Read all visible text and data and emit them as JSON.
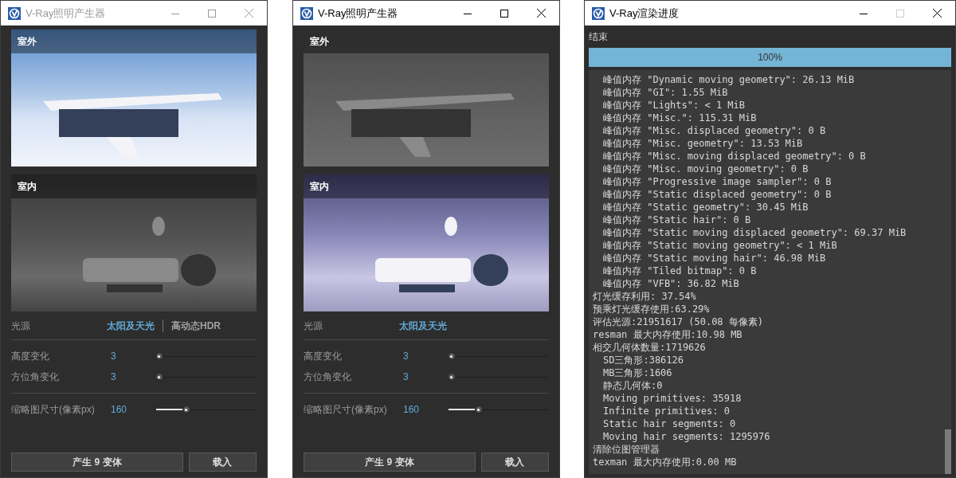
{
  "windows": [
    {
      "kind": "generator",
      "title": "V-Ray照明产生器",
      "active": false,
      "maximize_disabled": false,
      "previews": [
        {
          "kind": "exterior",
          "label": "室外",
          "selected": true
        },
        {
          "kind": "interior",
          "label": "室内",
          "selected": false
        }
      ],
      "light_source": {
        "label": "光源",
        "options": [
          {
            "label": "太阳及天光",
            "selected": true
          },
          {
            "label": "高动态HDR",
            "selected": false
          }
        ]
      },
      "slider_groups": [
        {
          "sliders": [
            {
              "label": "高度变化",
              "value": "3",
              "level": 0.03
            },
            {
              "label": "方位角变化",
              "value": "3",
              "level": 0.03
            }
          ]
        },
        {
          "sliders": [
            {
              "label": "缩略图尺寸(像素px)",
              "value": "160",
              "level": 0.3
            }
          ]
        }
      ],
      "buttons": [
        "产生 9 变体",
        "载入"
      ]
    },
    {
      "kind": "generator",
      "title": "V-Ray照明产生器",
      "active": true,
      "maximize_disabled": false,
      "previews": [
        {
          "kind": "exterior",
          "label": "室外",
          "selected": false
        },
        {
          "kind": "interior",
          "label": "室内",
          "selected": true
        }
      ],
      "light_source": {
        "label": "光源",
        "options": [
          {
            "label": "太阳及天光",
            "selected": true
          }
        ]
      },
      "slider_groups": [
        {
          "sliders": [
            {
              "label": "高度变化",
              "value": "3",
              "level": 0.03
            },
            {
              "label": "方位角变化",
              "value": "3",
              "level": 0.03
            }
          ]
        },
        {
          "sliders": [
            {
              "label": "缩略图尺寸(像素px)",
              "value": "160",
              "level": 0.3
            }
          ]
        }
      ],
      "buttons": [
        "产生 9 变体",
        "载入"
      ]
    },
    {
      "kind": "progress",
      "title": "V-Ray渲染进度",
      "active": true,
      "maximize_disabled": true,
      "status": "结束",
      "progress": {
        "label": "100%",
        "level": 1
      },
      "log": [
        {
          "children": [
            {
              "text": "峰值内存 \"Dynamic moving geometry\": 26.13 MiB"
            },
            {
              "text": "峰值内存 \"GI\": 1.55 MiB"
            },
            {
              "text": "峰值内存 \"Lights\": < 1 MiB"
            },
            {
              "text": "峰值内存 \"Misc.\": 115.31 MiB"
            },
            {
              "text": "峰值内存 \"Misc. displaced geometry\": 0 B"
            },
            {
              "text": "峰值内存 \"Misc. geometry\": 13.53 MiB"
            },
            {
              "text": "峰值内存 \"Misc. moving displaced geometry\": 0 B"
            },
            {
              "text": "峰值内存 \"Misc. moving geometry\": 0 B"
            },
            {
              "text": "峰值内存 \"Progressive image sampler\": 0 B"
            },
            {
              "text": "峰值内存 \"Static displaced geometry\": 0 B"
            },
            {
              "text": "峰值内存 \"Static geometry\": 30.45 MiB"
            },
            {
              "text": "峰值内存 \"Static hair\": 0 B"
            },
            {
              "text": "峰值内存 \"Static moving displaced geometry\": 69.37 MiB"
            },
            {
              "text": "峰值内存 \"Static moving geometry\": < 1 MiB"
            },
            {
              "text": "峰值内存 \"Static moving hair\": 46.98 MiB"
            },
            {
              "text": "峰值内存 \"Tiled bitmap\": 0 B"
            },
            {
              "text": "峰值内存 \"VFB\": 36.82 MiB"
            }
          ]
        },
        {
          "text": "灯光缓存利用: 37.54%"
        },
        {
          "text": "预乘灯光缓存使用:63.29%"
        },
        {
          "text": "评估光源:21951617 (50.08 每像素)"
        },
        {
          "text": "resman 最大内存使用:10.98 MB"
        },
        {
          "text": "相交几何体数量:1719626",
          "children": [
            {
              "text": "SD三角形:386126"
            },
            {
              "text": "MB三角形:1606"
            },
            {
              "text": "静态几何体:0"
            },
            {
              "text": "Moving primitives: 35918"
            },
            {
              "text": "Infinite primitives: 0"
            },
            {
              "text": "Static hair segments: 0"
            },
            {
              "text": "Moving hair segments: 1295976"
            }
          ]
        },
        {
          "text": "清除位图管理器"
        },
        {
          "text": "texman 最大内存使用:0.00 MB"
        }
      ]
    }
  ]
}
